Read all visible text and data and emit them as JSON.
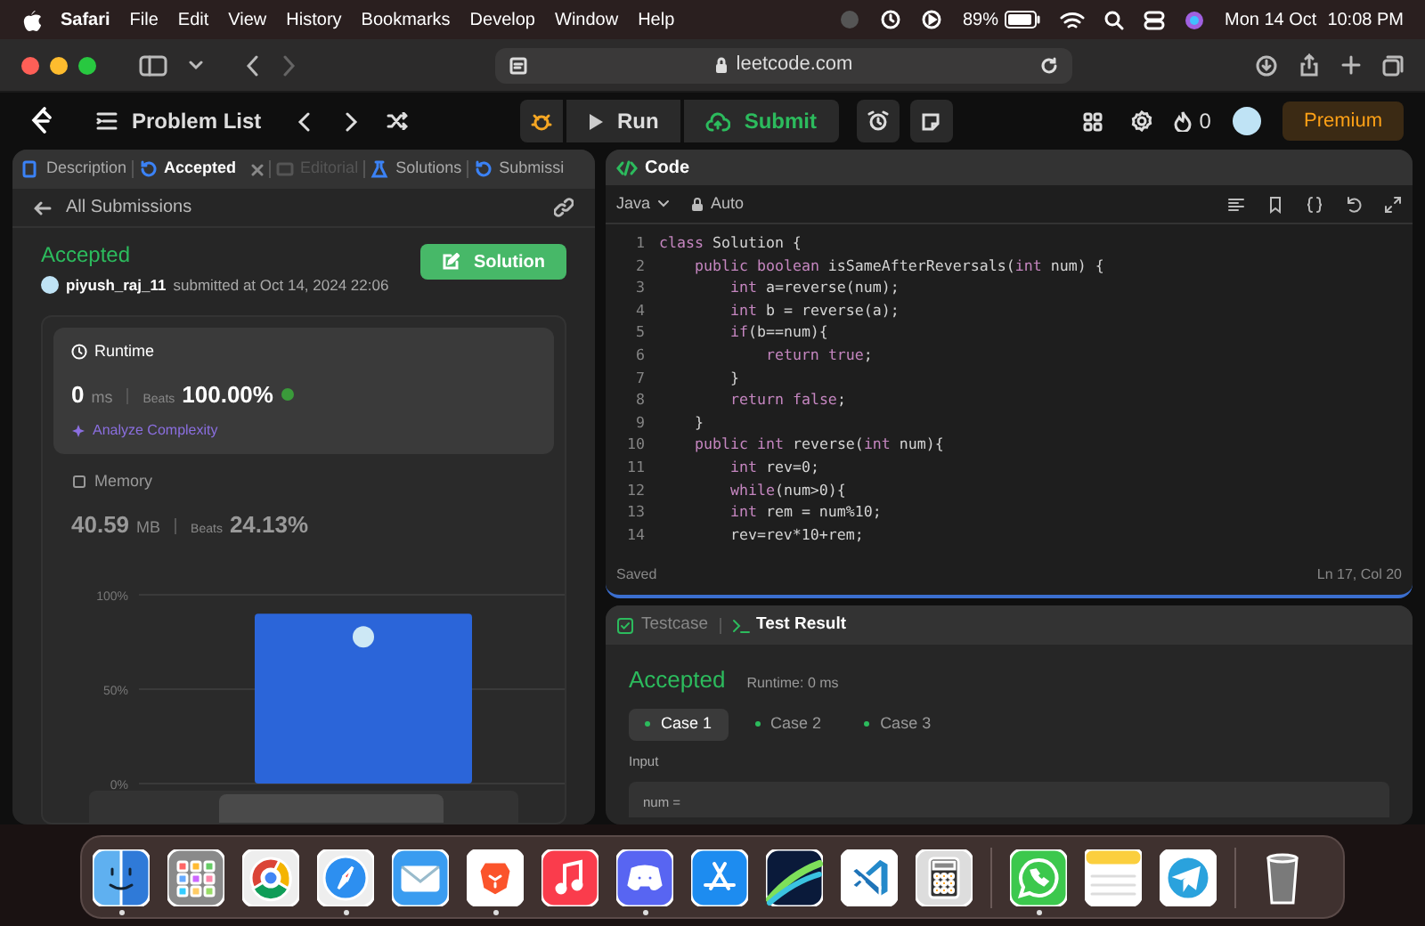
{
  "menu_bar": {
    "app": "Safari",
    "items": [
      "File",
      "Edit",
      "View",
      "History",
      "Bookmarks",
      "Develop",
      "Window",
      "Help"
    ],
    "battery": "89%",
    "date": "Mon 14 Oct",
    "time": "10:08 PM"
  },
  "browser": {
    "address": "leetcode.com"
  },
  "topbar": {
    "problem_list": "Problem List",
    "run": "Run",
    "submit": "Submit",
    "streak": "0",
    "premium": "Premium"
  },
  "left_tabs": [
    {
      "label": "Description",
      "selected": false,
      "disabled": false,
      "closable": false
    },
    {
      "label": "Accepted",
      "selected": true,
      "disabled": false,
      "closable": true
    },
    {
      "label": "Editorial",
      "selected": false,
      "disabled": true,
      "closable": false
    },
    {
      "label": "Solutions",
      "selected": false,
      "disabled": false,
      "closable": false
    },
    {
      "label": "Submissi",
      "selected": false,
      "disabled": false,
      "closable": false
    }
  ],
  "submission": {
    "back": "All Submissions",
    "status": "Accepted",
    "user": "piyush_raj_11",
    "submitted": "submitted at Oct 14, 2024 22:06",
    "solution_button": "Solution",
    "metrics": [
      {
        "title": "Runtime",
        "value": "0",
        "unit": "ms",
        "beats_label": "Beats",
        "beats": "100.00%",
        "selected": true,
        "link": "Analyze Complexity"
      },
      {
        "title": "Memory",
        "value": "40.59",
        "unit": "MB",
        "beats_label": "Beats",
        "beats": "24.13%",
        "selected": false
      }
    ],
    "chart_data": {
      "type": "bar",
      "values": [
        90
      ],
      "ylim": [
        0,
        100
      ],
      "yticks": [
        {
          "value": 0,
          "label": "0%"
        },
        {
          "value": 50,
          "label": "50%"
        },
        {
          "value": 100,
          "label": "100%"
        }
      ]
    }
  },
  "code": {
    "title": "Code",
    "language": "Java",
    "mode": "Auto",
    "lines": [
      {
        "number": "1",
        "text": "class Solution {"
      },
      {
        "number": "2",
        "text": "    public boolean isSameAfterReversals(int num) {"
      },
      {
        "number": "3",
        "text": "        int a=reverse(num);"
      },
      {
        "number": "4",
        "text": "        int b = reverse(a);"
      },
      {
        "number": "5",
        "text": "        if(b==num){"
      },
      {
        "number": "6",
        "text": "            return true;"
      },
      {
        "number": "7",
        "text": "        }"
      },
      {
        "number": "8",
        "text": "        return false;"
      },
      {
        "number": "9",
        "text": "    }"
      },
      {
        "number": "10",
        "text": "    public int reverse(int num){"
      },
      {
        "number": "11",
        "text": "        int rev=0;"
      },
      {
        "number": "12",
        "text": "        while(num>0){"
      },
      {
        "number": "13",
        "text": "        int rem = num%10;"
      },
      {
        "number": "14",
        "text": "        rev=rev*10+rem;"
      }
    ],
    "status": "Saved",
    "cursor": "Ln 17, Col 20"
  },
  "test": {
    "tabs": [
      {
        "label": "Testcase",
        "selected": false
      },
      {
        "label": "Test Result",
        "selected": true
      }
    ],
    "result": "Accepted",
    "runtime": "Runtime: 0 ms",
    "cases": [
      {
        "label": "Case 1",
        "selected": true
      },
      {
        "label": "Case 2",
        "selected": false
      },
      {
        "label": "Case 3",
        "selected": false
      }
    ],
    "input_label": "Input",
    "input_value": "num ="
  },
  "dock": [
    {
      "running": true
    },
    {
      "running": false
    },
    {
      "running": false
    },
    {
      "running": true
    },
    {
      "running": false
    },
    {
      "running": true
    },
    {
      "running": false
    },
    {
      "running": true
    },
    {
      "running": false
    },
    {
      "running": false
    },
    {
      "running": false
    },
    {
      "running": false
    },
    {
      "running": true
    },
    {
      "running": false
    },
    {
      "running": false
    },
    {
      "running": false
    }
  ]
}
